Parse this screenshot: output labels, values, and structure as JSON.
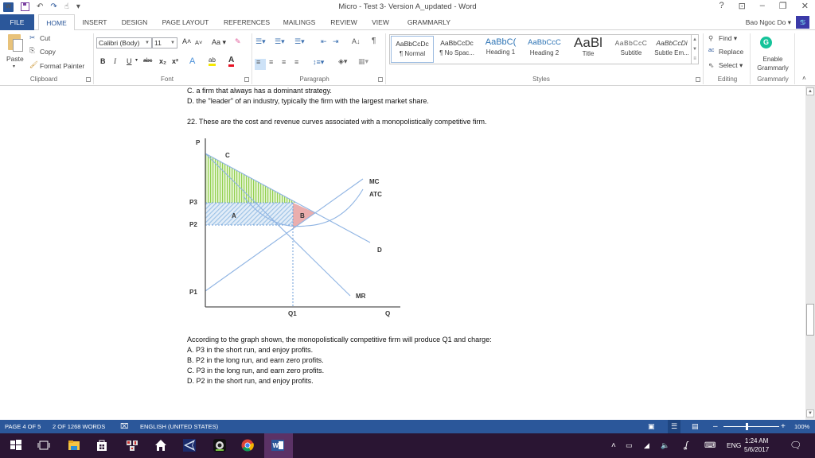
{
  "window": {
    "title": "Micro - Test 3- Version A_updated - Word",
    "controls": {
      "help": "?",
      "ribbon_display": "⊡",
      "minimize": "–",
      "restore": "❐",
      "close": "✕"
    }
  },
  "quick_access": {
    "undo": "↶",
    "redo": "↷",
    "touch": "☝",
    "customize": "▾"
  },
  "tabs": [
    {
      "label": "FILE"
    },
    {
      "label": "HOME"
    },
    {
      "label": "INSERT"
    },
    {
      "label": "DESIGN"
    },
    {
      "label": "PAGE LAYOUT"
    },
    {
      "label": "REFERENCES"
    },
    {
      "label": "MAILINGS"
    },
    {
      "label": "REVIEW"
    },
    {
      "label": "VIEW"
    },
    {
      "label": "GRAMMARLY"
    }
  ],
  "user": {
    "name": "Bao Ngoc Do",
    "avatar_glyph": "♋"
  },
  "ribbon": {
    "clipboard": {
      "label": "Clipboard",
      "paste": "Paste",
      "cut": "Cut",
      "copy": "Copy",
      "format_painter": "Format Painter"
    },
    "font": {
      "label": "Font",
      "font_name": "Calibri (Body)",
      "font_size": "11",
      "grow": "A˄",
      "shrink": "A˅",
      "case": "Aa",
      "bold": "B",
      "italic": "I",
      "underline": "U",
      "strike": "abc",
      "subscript": "x₂",
      "superscript": "x²",
      "text_effects": "A",
      "highlight": "ab",
      "font_color": "A",
      "highlight_color": "#f5e800",
      "font_color_value": "#e81123"
    },
    "paragraph": {
      "label": "Paragraph",
      "sort": "A↓",
      "pilcrow": "¶"
    },
    "styles": {
      "label": "Styles",
      "items": [
        {
          "preview": "AaBbCcDc",
          "name": "¶ Normal"
        },
        {
          "preview": "AaBbCcDc",
          "name": "¶ No Spac..."
        },
        {
          "preview": "AaBbC(",
          "name": "Heading 1"
        },
        {
          "preview": "AaBbCcC",
          "name": "Heading 2"
        },
        {
          "preview": "AaBl",
          "name": "Title"
        },
        {
          "preview": "AaBbCcC",
          "name": "Subtitle"
        },
        {
          "preview": "AaBbCcDi",
          "name": "Subtle Em..."
        }
      ]
    },
    "editing": {
      "label": "Editing",
      "find": "Find",
      "replace": "Replace",
      "select": "Select"
    },
    "grammarly": {
      "label": "Grammarly",
      "enable_line1": "Enable",
      "enable_line2": "Grammarly",
      "brand_color": "#15c39a"
    }
  },
  "document": {
    "lines_top": [
      "C. a firm that always has a dominant strategy.",
      "D. the \"leader\" of an industry, typically the firm with the largest market share."
    ],
    "question": "22. These are the cost and revenue curves associated with a monopolistically competitive firm.",
    "answer_lines": [
      "According to the graph shown, the monopolistically competitive firm will produce Q1 and charge:",
      "A. P3 in the short run, and enjoy profits.",
      "B. P2 in the long run, and earn zero profits.",
      "C. P3 in the long run, and earn zero profits.",
      "D. P2 in the short run, and enjoy profits."
    ]
  },
  "chart_data": {
    "type": "line",
    "title": "",
    "xlabel": "Q",
    "ylabel": "P",
    "y_ticks": [
      "P3",
      "P2",
      "P1"
    ],
    "x_ticks": [
      "Q1"
    ],
    "curves": [
      {
        "name": "D",
        "shape": "downward line",
        "label": "D"
      },
      {
        "name": "MR",
        "shape": "steeper downward line",
        "label": "MR"
      },
      {
        "name": "MC",
        "shape": "upward line from P1",
        "label": "MC"
      },
      {
        "name": "ATC",
        "shape": "U-shaped curve, minimum near P2",
        "label": "ATC"
      }
    ],
    "regions": [
      {
        "label": "C",
        "description": "area under demand above P3",
        "color": "#92d050"
      },
      {
        "label": "A",
        "description": "rectangle between P2 and P3 up to Q1",
        "color": "#9dc3e6"
      },
      {
        "label": "B",
        "description": "triangle right of Q1 between D and MC",
        "color": "#e6a0a0"
      }
    ],
    "grid": false
  },
  "status": {
    "page": "PAGE 4 OF 5",
    "words": "2 OF 1268 WORDS",
    "language": "ENGLISH (UNITED STATES)",
    "zoom": "100%",
    "zoom_minus": "–",
    "zoom_plus": "+"
  },
  "taskbar": {
    "language": "ENG",
    "time": "1:24 AM",
    "date": "5/6/2017"
  },
  "colors": {
    "word_blue": "#2b579a",
    "taskbar": "#2a1533"
  }
}
